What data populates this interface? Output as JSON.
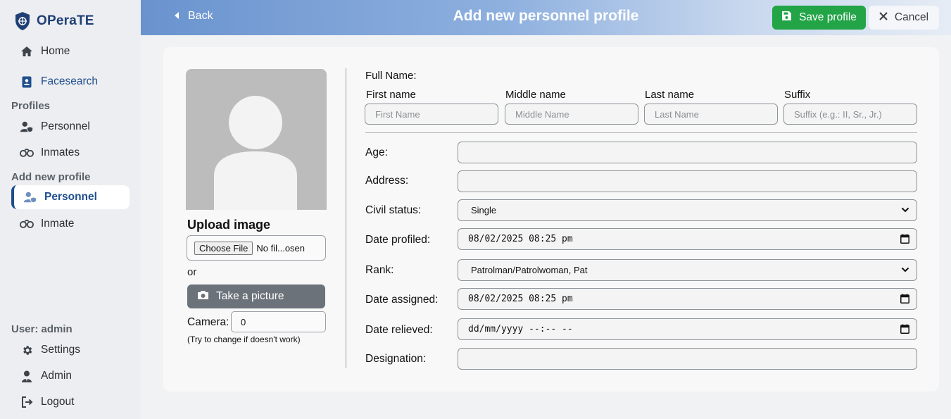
{
  "app": {
    "name": "OPeraTE"
  },
  "sidebar": {
    "home": "Home",
    "facesearch": "Facesearch",
    "profiles_section": "Profiles",
    "personnel": "Personnel",
    "inmates": "Inmates",
    "add_section": "Add new profile",
    "add_personnel": "Personnel",
    "add_inmate": "Inmate",
    "user_label": "User: admin",
    "settings": "Settings",
    "admin": "Admin",
    "logout": "Logout"
  },
  "header": {
    "back": "Back",
    "title": "Add new personnel profile",
    "save": "Save profile",
    "cancel": "Cancel"
  },
  "upload": {
    "title": "Upload image",
    "choose_file": "Choose File",
    "file_status": "No fil...osen",
    "or": "or",
    "take_picture": "Take a picture",
    "camera_label": "Camera:",
    "camera_value": "0",
    "camera_hint": "(Try to change if doesn't work)"
  },
  "form": {
    "full_name_label": "Full Name:",
    "first_name_label": "First name",
    "middle_name_label": "Middle name",
    "last_name_label": "Last name",
    "suffix_label": "Suffix",
    "first_name_placeholder": "First Name",
    "middle_name_placeholder": "Middle Name",
    "last_name_placeholder": "Last Name",
    "suffix_placeholder": "Suffix (e.g.: II, Sr., Jr.)",
    "age_label": "Age:",
    "address_label": "Address:",
    "civil_status_label": "Civil status:",
    "civil_status_value": "Single",
    "date_profiled_label": "Date profiled:",
    "date_profiled_value": "08/02/2025 08:25 pm",
    "rank_label": "Rank:",
    "rank_value": "Patrolman/Patrolwoman, Pat",
    "date_assigned_label": "Date assigned:",
    "date_assigned_value": "08/02/2025 08:25 pm",
    "date_relieved_label": "Date relieved:",
    "date_relieved_value": "dd/mm/yyyy --:-- --",
    "designation_label": "Designation:"
  },
  "colors": {
    "brand": "#1f3f75",
    "save_green": "#22a447",
    "take_picture_gray": "#6c727a",
    "active_blue": "#1f4e8c"
  }
}
